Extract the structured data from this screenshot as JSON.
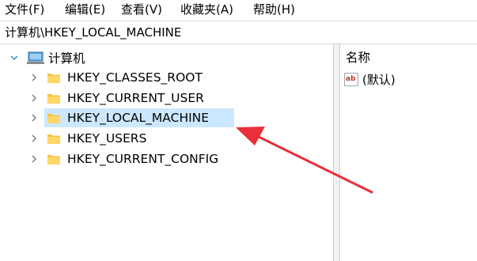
{
  "menubar": {
    "items": [
      "文件(F)",
      "编辑(E)",
      "查看(V)",
      "收藏夹(A)",
      "帮助(H)"
    ]
  },
  "address": {
    "path": "计算机\\HKEY_LOCAL_MACHINE"
  },
  "tree": {
    "root_label": "计算机",
    "keys": [
      {
        "label": "HKEY_CLASSES_ROOT",
        "selected": false
      },
      {
        "label": "HKEY_CURRENT_USER",
        "selected": false
      },
      {
        "label": "HKEY_LOCAL_MACHINE",
        "selected": true
      },
      {
        "label": "HKEY_USERS",
        "selected": false
      },
      {
        "label": "HKEY_CURRENT_CONFIG",
        "selected": false
      }
    ]
  },
  "values_pane": {
    "column_name": "名称",
    "rows": [
      {
        "icon": "string-value-icon",
        "icon_text": "ab",
        "name": "(默认)"
      }
    ]
  },
  "colors": {
    "selection": "#cce8ff",
    "folder": "#f4c542",
    "annotation_arrow": "#e8303a"
  }
}
